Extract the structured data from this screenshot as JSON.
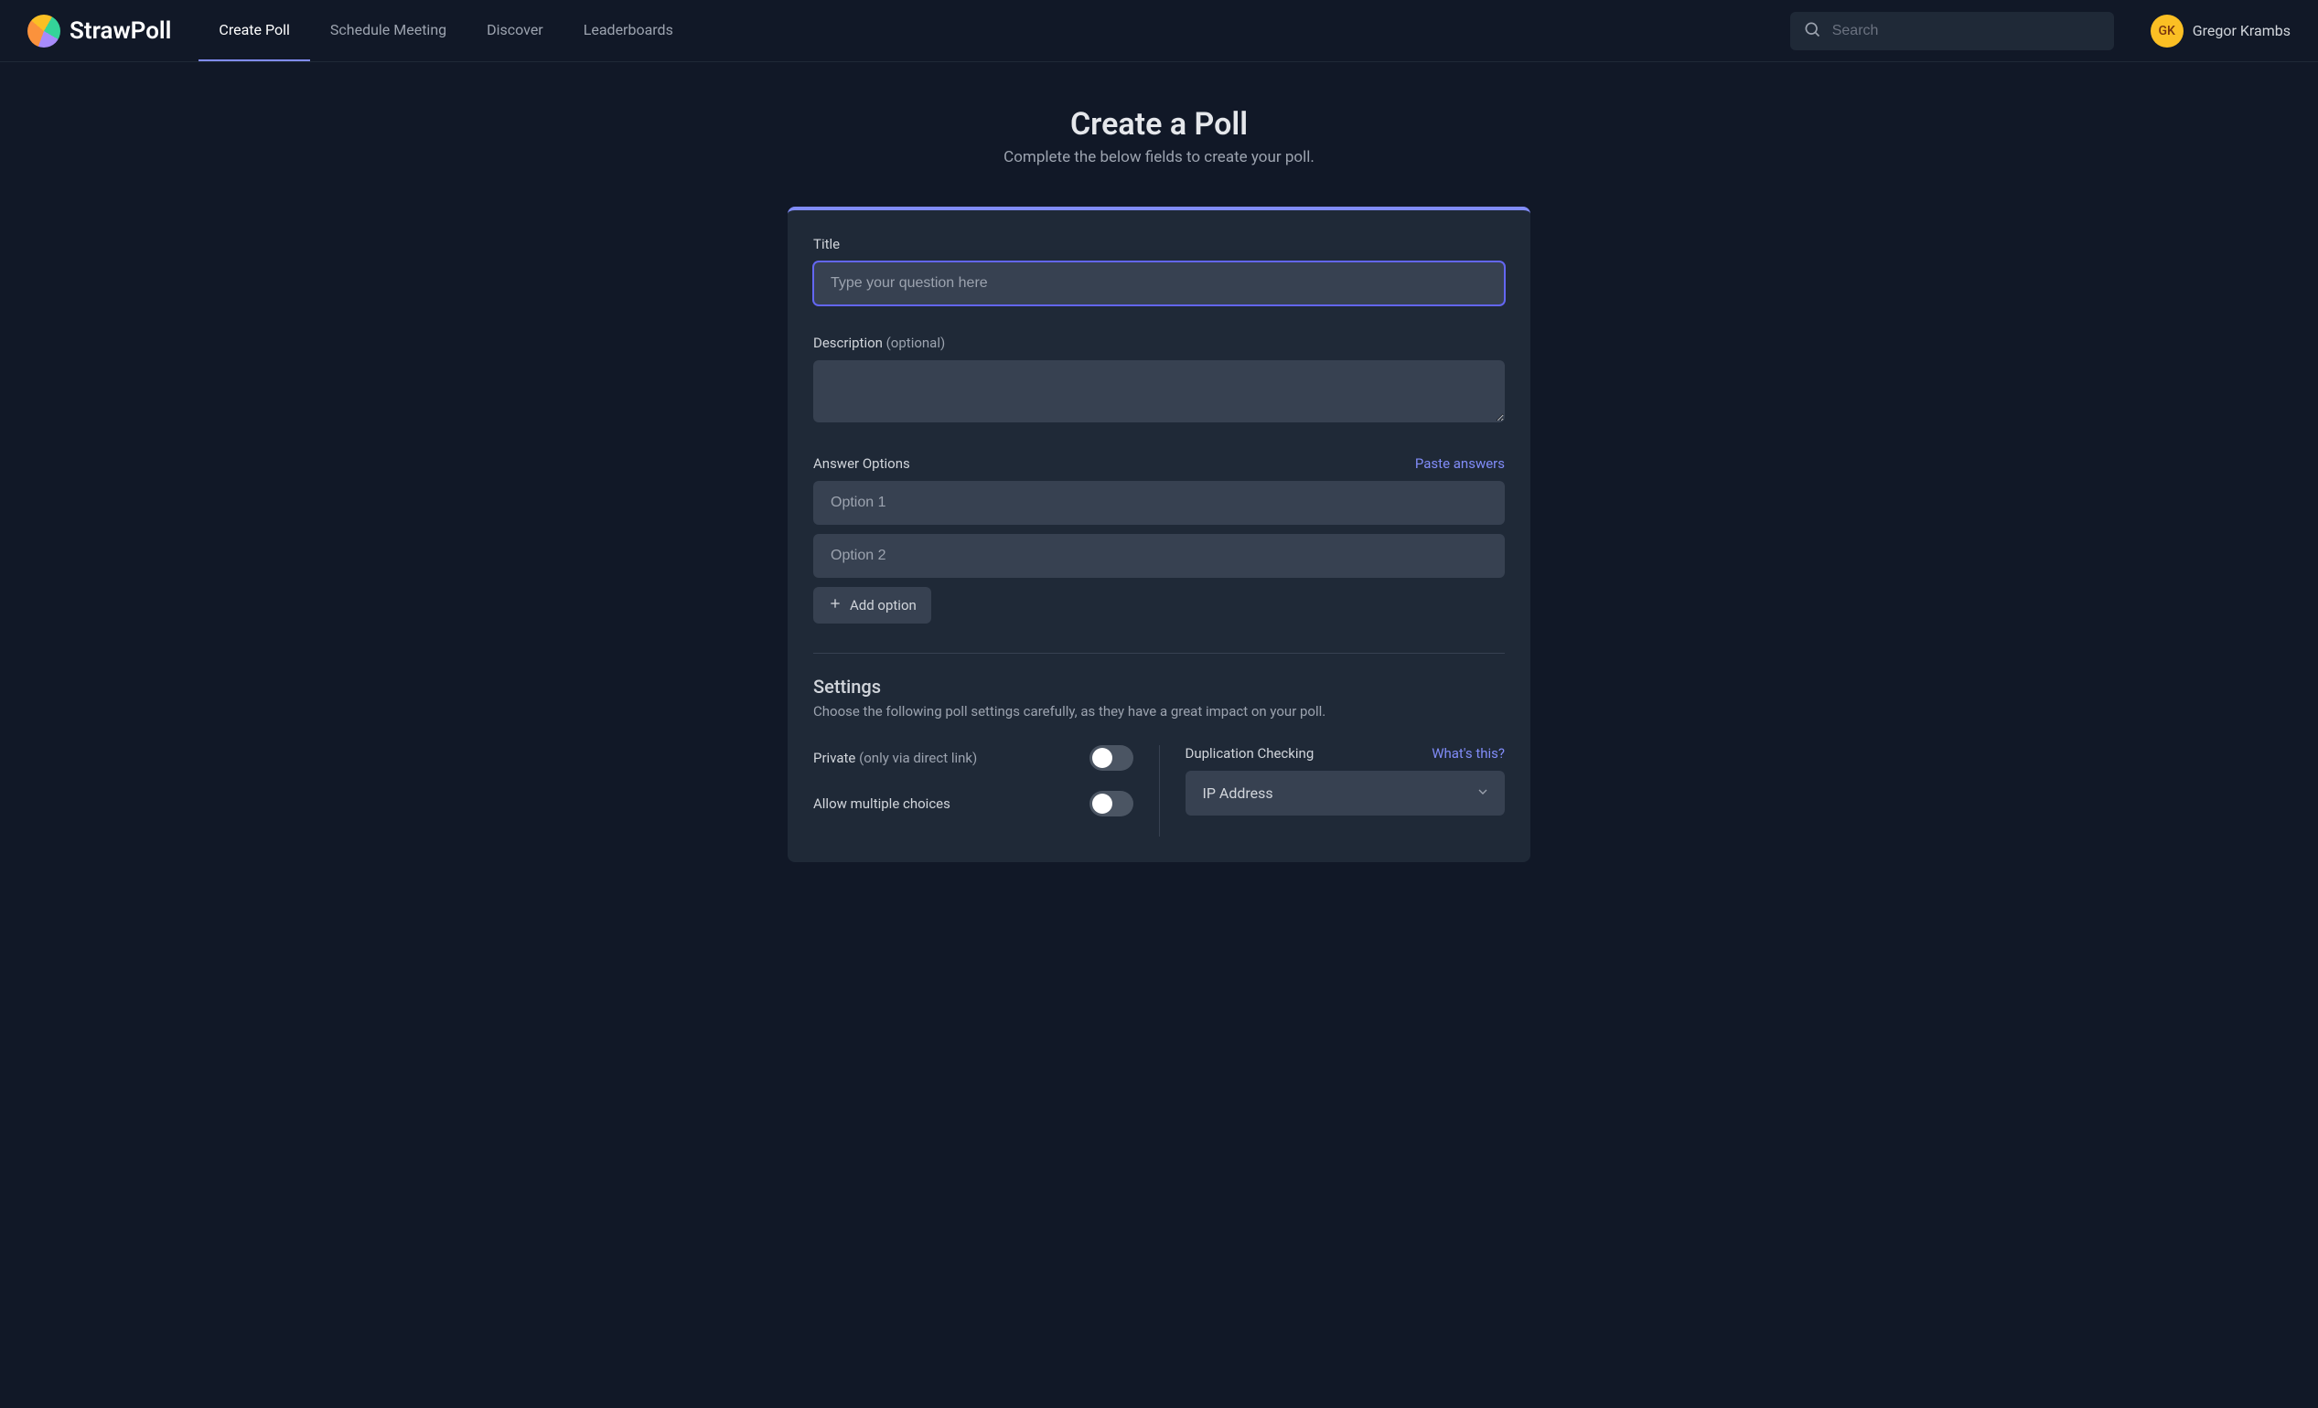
{
  "header": {
    "brand": "StrawPoll",
    "nav": [
      {
        "label": "Create Poll",
        "active": true
      },
      {
        "label": "Schedule Meeting",
        "active": false
      },
      {
        "label": "Discover",
        "active": false
      },
      {
        "label": "Leaderboards",
        "active": false
      }
    ],
    "search_placeholder": "Search",
    "user": {
      "initials": "GK",
      "name": "Gregor Krambs"
    }
  },
  "page": {
    "title": "Create a Poll",
    "subtitle": "Complete the below fields to create your poll."
  },
  "form": {
    "title_label": "Title",
    "title_placeholder": "Type your question here",
    "description_label": "Description",
    "description_hint": "(optional)",
    "answer_options_label": "Answer Options",
    "paste_answers": "Paste answers",
    "options": [
      {
        "placeholder": "Option 1"
      },
      {
        "placeholder": "Option 2"
      }
    ],
    "add_option": "Add option"
  },
  "settings": {
    "heading": "Settings",
    "subheading": "Choose the following poll settings carefully, as they have a great impact on your poll.",
    "private_label": "Private",
    "private_hint": "(only via direct link)",
    "multiple_label": "Allow multiple choices",
    "duplication_label": "Duplication Checking",
    "whats_this": "What's this?",
    "duplication_value": "IP Address"
  }
}
